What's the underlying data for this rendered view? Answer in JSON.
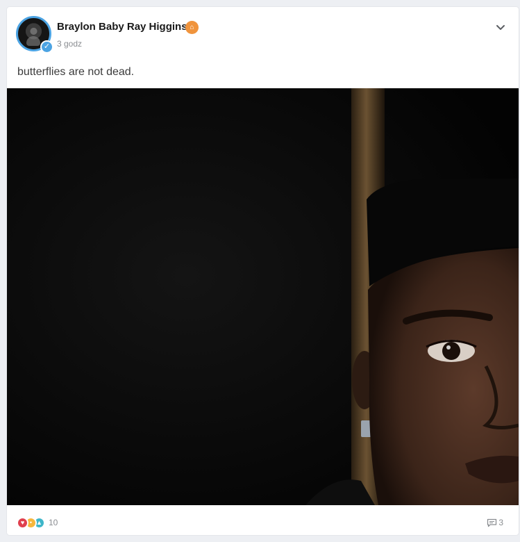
{
  "post": {
    "author": "Braylon Baby Ray Higgins",
    "author_badge_icon": "owner-badge",
    "verified_icon": "verified-check",
    "time": "3 godz",
    "text": "butterflies are not dead."
  },
  "media": {
    "alt": "Dark 3D render of a man's face peeking in from the right edge beside a wooden post",
    "colors": {
      "background": "#050505",
      "skin": "#4a2f22",
      "post": "#5a4428"
    }
  },
  "reactions": {
    "icons": [
      "heart-icon",
      "wow-icon",
      "like-icon"
    ],
    "count": "10"
  },
  "comments": {
    "icon": "comment-icon",
    "count": "3"
  },
  "colors": {
    "accent": "#4ba3e3",
    "badge": "#f0943d",
    "muted_text": "#8a8d91"
  }
}
